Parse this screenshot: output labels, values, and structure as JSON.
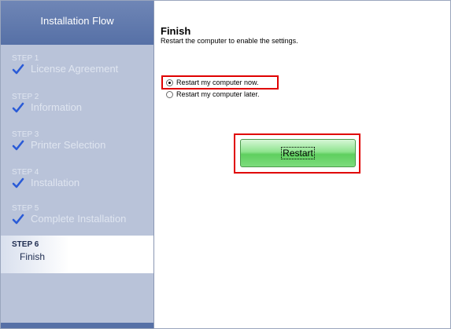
{
  "sidebar": {
    "header": "Installation Flow",
    "steps": [
      {
        "number": "STEP 1",
        "label": "License Agreement",
        "completed": true
      },
      {
        "number": "STEP 2",
        "label": "Information",
        "completed": true
      },
      {
        "number": "STEP 3",
        "label": "Printer Selection",
        "completed": true
      },
      {
        "number": "STEP 4",
        "label": "Installation",
        "completed": true
      },
      {
        "number": "STEP 5",
        "label": "Complete Installation",
        "completed": true
      }
    ],
    "current_step": {
      "number": "STEP 6",
      "label": "Finish"
    }
  },
  "main": {
    "title": "Finish",
    "subtitle": "Restart the computer to enable the settings.",
    "options": [
      {
        "label": "Restart my computer now.",
        "selected": true
      },
      {
        "label": "Restart my computer later.",
        "selected": false
      }
    ],
    "restart_button": "Restart"
  },
  "colors": {
    "sidebar_bg": "#b9c3d9",
    "sidebar_header": "#5670a6",
    "check_blue": "#2a5bd7",
    "button_green": "#7ddc7d",
    "highlight_red": "#e00000"
  }
}
